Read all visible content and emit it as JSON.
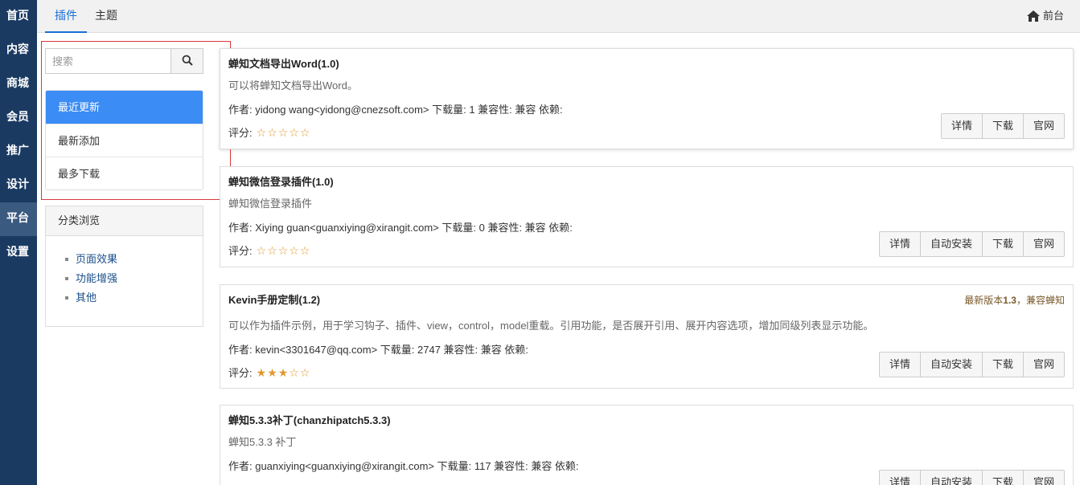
{
  "leftnav": {
    "items": [
      {
        "label": "首页"
      },
      {
        "label": "内容"
      },
      {
        "label": "商城"
      },
      {
        "label": "会员"
      },
      {
        "label": "推广"
      },
      {
        "label": "设计"
      },
      {
        "label": "平台"
      },
      {
        "label": "设置"
      }
    ],
    "active_index": 6
  },
  "topbar": {
    "tabs": [
      {
        "label": "插件"
      },
      {
        "label": "主题"
      }
    ],
    "frontend_label": "前台"
  },
  "sidebar": {
    "search_placeholder": "搜索",
    "menu": [
      {
        "label": "最近更新"
      },
      {
        "label": "最新添加"
      },
      {
        "label": "最多下载"
      }
    ],
    "category_title": "分类浏览",
    "categories": [
      {
        "label": "页面效果"
      },
      {
        "label": "功能增强"
      },
      {
        "label": "其他"
      }
    ]
  },
  "plugins": [
    {
      "title": "蝉知文档导出Word(1.0)",
      "desc": "可以将蝉知文档导出Word。",
      "meta": "作者: yidong wang<yidong@cnezsoft.com> 下载量: 1 兼容性: 兼容 依赖:",
      "rating_label": "评分:",
      "rating": 0,
      "buttons": [
        "详情",
        "下载",
        "官网"
      ]
    },
    {
      "title": "蝉知微信登录插件(1.0)",
      "desc": "蝉知微信登录插件",
      "meta": "作者: Xiying guan<guanxiying@xirangit.com> 下载量: 0 兼容性: 兼容 依赖:",
      "rating_label": "评分:",
      "rating": 0,
      "buttons": [
        "详情",
        "自动安装",
        "下载",
        "官网"
      ]
    },
    {
      "title": "Kevin手册定制(1.2)",
      "desc": "可以作为插件示例，用于学习钩子、插件、view，control，model重载。引用功能，是否展开引用、展开内容选项，增加同级列表显示功能。",
      "meta": "作者: kevin<3301647@qq.com> 下载量: 2747 兼容性: 兼容 依赖:",
      "rating_label": "评分:",
      "rating": 3,
      "latest_prefix": "最新版本",
      "latest_version": "1.3",
      "latest_suffix": "，兼容蝉知",
      "buttons": [
        "详情",
        "自动安装",
        "下载",
        "官网"
      ]
    },
    {
      "title": "蝉知5.3.3补丁(chanzhipatch5.3.3)",
      "desc": "蝉知5.3.3 补丁",
      "meta": "作者: guanxiying<guanxiying@xirangit.com> 下载量: 117 兼容性: 兼容 依赖:",
      "buttons": [
        "详情",
        "自动安装",
        "下载",
        "官网"
      ]
    }
  ],
  "colors": {
    "nav_bg": "#1a3a62",
    "accent": "#3b8cf5",
    "tab_active": "#1a6fd6",
    "star": "#e0982f",
    "highlight": "#d9383c"
  }
}
